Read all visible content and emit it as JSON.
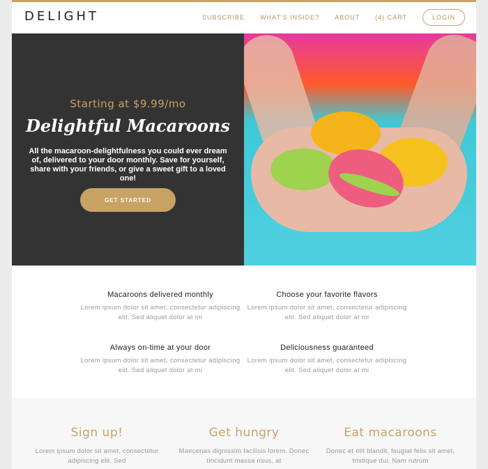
{
  "header": {
    "logo": "DELIGHT",
    "nav": {
      "subscribe": "SUBSCRIBE",
      "whats_inside": "WHAT'S INSIDE?",
      "about": "ABOUT",
      "cart": "(4) CART",
      "login": "LOGIN"
    },
    "accent_color": "#c9a363"
  },
  "hero": {
    "subtitle": "Starting at $9.99/mo",
    "title": "Delightful Macaroons",
    "text": "All the macaroon-delightfulness you could ever dream of, delivered to your door monthly. Save for yourself, share with your friends, or give a sweet gift to a loved one!",
    "button": "GET STARTED",
    "background_color": "#333333"
  },
  "features": [
    {
      "title": "Macaroons delivered monthly",
      "text": "Lorem ipsum dolor sit amet, consectetur adipiscing elit. Sed aliquet dolor at mi"
    },
    {
      "title": "Choose your favorite flavors",
      "text": "Lorem ipsum dolor sit amet, consectetur adipiscing elit. Sed aliquet dolor at mi"
    },
    {
      "title": "Always on-time at your door",
      "text": "Lorem ipsum dolor sit amet, consectetur adipiscing elit. Sed aliquet dolor at mi"
    },
    {
      "title": "Deliciousness guaranteed",
      "text": "Lorem ipsum dolor sit amet, consectetur adipiscing elit. Sed aliquet dolor at mi"
    }
  ],
  "steps": [
    {
      "title": "Sign up!",
      "text": "Lorem ipsum dolor sit amet, consectetur adipiscing elit. Sed"
    },
    {
      "title": "Get hungry",
      "text": "Maecenas dignissim facilisis lorem. Donec tincidunt massa risus, at"
    },
    {
      "title": "Eat macaroons",
      "text": "Donec et elit blandit, feugiat felis sit amet, tristique dui. Nam rutrum"
    }
  ]
}
